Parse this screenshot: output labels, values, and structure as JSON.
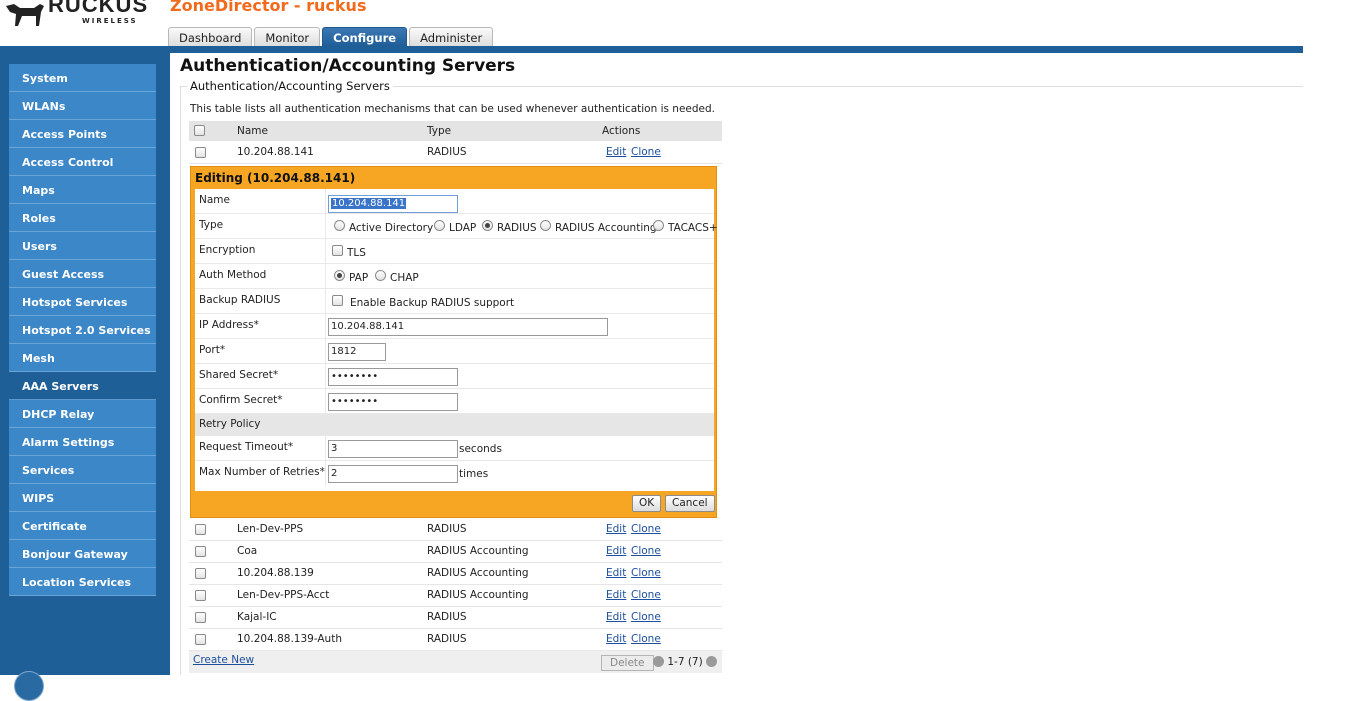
{
  "brand": {
    "name": "RUCKUS",
    "tagline": "WIRELESS",
    "color": "#f26b1d"
  },
  "app_title": "ZoneDirector - ruckus",
  "tabs": [
    {
      "label": "Dashboard"
    },
    {
      "label": "Monitor"
    },
    {
      "label": "Configure",
      "active": true
    },
    {
      "label": "Administer"
    }
  ],
  "sidebar": {
    "items": [
      {
        "label": "System"
      },
      {
        "label": "WLANs"
      },
      {
        "label": "Access Points"
      },
      {
        "label": "Access Control"
      },
      {
        "label": "Maps"
      },
      {
        "label": "Roles"
      },
      {
        "label": "Users"
      },
      {
        "label": "Guest Access"
      },
      {
        "label": "Hotspot Services"
      },
      {
        "label": "Hotspot 2.0 Services"
      },
      {
        "label": "Mesh"
      },
      {
        "label": "AAA Servers",
        "active": true
      },
      {
        "label": "DHCP Relay"
      },
      {
        "label": "Alarm Settings"
      },
      {
        "label": "Services"
      },
      {
        "label": "WIPS"
      },
      {
        "label": "Certificate"
      },
      {
        "label": "Bonjour Gateway"
      },
      {
        "label": "Location Services"
      }
    ]
  },
  "page": {
    "title": "Authentication/Accounting Servers",
    "section_title": "Authentication/Accounting Servers",
    "description": "This table lists all authentication mechanisms that can be used whenever authentication is needed."
  },
  "table": {
    "columns": [
      "Name",
      "Type",
      "Actions"
    ],
    "edit_label": "Edit",
    "clone_label": "Clone",
    "rows": [
      {
        "name": "10.204.88.141",
        "type": "RADIUS"
      },
      {
        "name": "Len-Dev-PPS",
        "type": "RADIUS"
      },
      {
        "name": "Coa",
        "type": "RADIUS Accounting"
      },
      {
        "name": "10.204.88.139",
        "type": "RADIUS Accounting"
      },
      {
        "name": "Len-Dev-PPS-Acct",
        "type": "RADIUS Accounting"
      },
      {
        "name": "Kajal-IC",
        "type": "RADIUS"
      },
      {
        "name": "10.204.88.139-Auth",
        "type": "RADIUS"
      }
    ],
    "create_new": "Create New",
    "delete_label": "Delete",
    "pager": "1-7 (7)"
  },
  "editor": {
    "title": "Editing (10.204.88.141)",
    "name_label": "Name",
    "name_value": "10.204.88.141",
    "type_label": "Type",
    "type_options": [
      "Active Directory",
      "LDAP",
      "RADIUS",
      "RADIUS Accounting",
      "TACACS+"
    ],
    "type_selected": "RADIUS",
    "encryption_label": "Encryption",
    "encryption_option": "TLS",
    "auth_method_label": "Auth Method",
    "auth_options": [
      "PAP",
      "CHAP"
    ],
    "auth_selected": "PAP",
    "backup_label": "Backup RADIUS",
    "backup_option": "Enable Backup RADIUS support",
    "ip_label": "IP Address*",
    "ip_value": "10.204.88.141",
    "port_label": "Port*",
    "port_value": "1812",
    "secret_label": "Shared Secret*",
    "secret_value": "••••••••",
    "confirm_label": "Confirm Secret*",
    "confirm_value": "••••••••",
    "retry_label": "Retry Policy",
    "timeout_label": "Request Timeout*",
    "timeout_value": "3",
    "timeout_unit": "seconds",
    "retries_label": "Max Number of Retries*",
    "retries_value": "2",
    "retries_unit": "times",
    "ok_label": "OK",
    "cancel_label": "Cancel"
  }
}
